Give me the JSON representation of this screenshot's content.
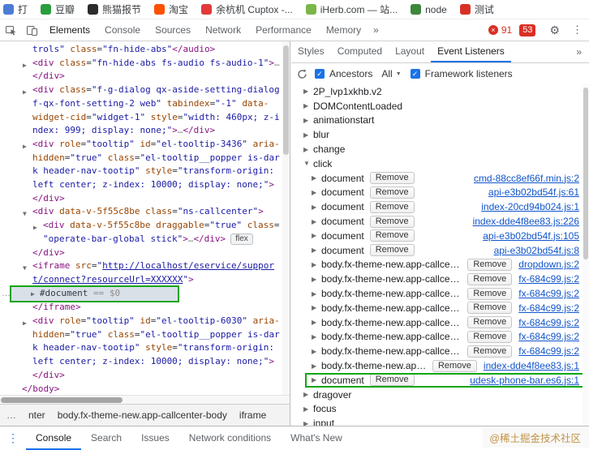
{
  "watermark": "@稀土掘金技术社区",
  "icons": {
    "gear": "⚙",
    "menu": "⋮",
    "drawer_menu": "⋮",
    "error": "×",
    "check": "✓",
    "dropdown": "▼",
    "twisty_collapsed": "▶",
    "twisty_expanded": "▼",
    "overflow": "…"
  },
  "bookmarks": [
    {
      "label": "打",
      "color": "#4d7cd6"
    },
    {
      "label": "豆瓣",
      "color": "#2a9d3f"
    },
    {
      "label": "熊猫报节",
      "color": "#2b2b2b"
    },
    {
      "label": "淘宝",
      "color": "#ff5000"
    },
    {
      "label": "余杭机 Cuptox -...",
      "color": "#e03a3a"
    },
    {
      "label": "iHerb.com — 站...",
      "color": "#7ab648"
    },
    {
      "label": "node",
      "color": "#3c873a"
    },
    {
      "label": "测试",
      "color": "#d93025"
    }
  ],
  "devtools": {
    "tabs": [
      "Elements",
      "Console",
      "Sources",
      "Network",
      "Performance",
      "Memory"
    ],
    "active_tab": "Elements",
    "more_tabs_icon": "»",
    "error_count": "91",
    "badge_count": "53"
  },
  "sidebar": {
    "tabs": [
      "Styles",
      "Computed",
      "Layout",
      "Event Listeners"
    ],
    "active_tab": "Event Listeners",
    "more_icon": "»",
    "toolbar": {
      "ancestors_label": "Ancestors",
      "filter_value": "All",
      "framework_label": "Framework listeners"
    },
    "remove_label": "Remove",
    "events": [
      {
        "name": "2P_lvp1xkhb.v2"
      },
      {
        "name": "DOMContentLoaded"
      },
      {
        "name": "animationstart"
      },
      {
        "name": "blur"
      },
      {
        "name": "change"
      },
      {
        "name": "click",
        "expanded": true,
        "listeners": [
          {
            "target": "document",
            "source": "cmd-88cc8ef66f.min.js:2"
          },
          {
            "target": "document",
            "source": "api-e3b02bd54f.js:61"
          },
          {
            "target": "document",
            "source": "index-20cd94b024.js:1"
          },
          {
            "target": "document",
            "source": "index-dde4f8ee83.js:226"
          },
          {
            "target": "document",
            "source": "api-e3b02bd54f.js:105"
          },
          {
            "target": "document",
            "source": "api-e3b02bd54f.js:8"
          },
          {
            "target": "body.fx-theme-new.app-callcenter-body",
            "source": "dropdown.js:2"
          },
          {
            "target": "body.fx-theme-new.app-callcenter-body",
            "source": "fx-684c99.js:2"
          },
          {
            "target": "body.fx-theme-new.app-callcenter-body",
            "source": "fx-684c99.js:2"
          },
          {
            "target": "body.fx-theme-new.app-callcenter-body",
            "source": "fx-684c99.js:2"
          },
          {
            "target": "body.fx-theme-new.app-callcenter-body",
            "source": "fx-684c99.js:2"
          },
          {
            "target": "body.fx-theme-new.app-callcenter-body",
            "source": "fx-684c99.js:2"
          },
          {
            "target": "body.fx-theme-new.app-callcenter-body",
            "source": "fx-684c99.js:2"
          },
          {
            "target": "body.fx-theme-new.app-callcenter-body",
            "source": "index-dde4f8ee83.js:1"
          },
          {
            "target": "document",
            "source": "udesk-phone-bar.es6.js:1",
            "highlight": true
          }
        ]
      },
      {
        "name": "dragover"
      },
      {
        "name": "focus"
      },
      {
        "name": "input"
      }
    ]
  },
  "elements": {
    "flex_badge": "flex",
    "breadcrumb": {
      "overflow": "…",
      "items": [
        "nter",
        "body.fx-theme-new.app-callcenter-body",
        "iframe"
      ]
    },
    "code_lines": [
      {
        "ind": 2,
        "seg": [
          [
            "v",
            "trols\" "
          ],
          [
            "a",
            "class"
          ],
          [
            "p",
            "="
          ],
          [
            "v",
            "\"fn-hide-abs\""
          ],
          [
            "t",
            "</audio>"
          ]
        ]
      },
      {
        "ind": 2,
        "arrow": "r",
        "seg": [
          [
            "t",
            "<div"
          ],
          [
            "p",
            " "
          ],
          [
            "a",
            "class"
          ],
          [
            "p",
            "="
          ],
          [
            "v",
            "\"fn-hide-abs fs-audio fs-audio-1\""
          ],
          [
            "t",
            ">"
          ],
          [
            "g",
            "…"
          ]
        ]
      },
      {
        "ind": 2,
        "seg": [
          [
            "t",
            "</div>"
          ]
        ]
      },
      {
        "ind": 2,
        "arrow": "r",
        "seg": [
          [
            "t",
            "<div"
          ],
          [
            "p",
            " "
          ],
          [
            "a",
            "class"
          ],
          [
            "p",
            "="
          ],
          [
            "v",
            "\"f-g-dialog qx-aside-setting-dialog"
          ]
        ]
      },
      {
        "ind": 2,
        "seg": [
          [
            "v",
            "f-qx-font-setting-2 web\""
          ],
          [
            "p",
            " "
          ],
          [
            "a",
            "tabindex"
          ],
          [
            "p",
            "="
          ],
          [
            "v",
            "\"-1\""
          ],
          [
            "p",
            " "
          ],
          [
            "a",
            "data-"
          ]
        ]
      },
      {
        "ind": 2,
        "seg": [
          [
            "a",
            "widget-cid"
          ],
          [
            "p",
            "="
          ],
          [
            "v",
            "\"widget-1\""
          ],
          [
            "p",
            " "
          ],
          [
            "a",
            "style"
          ],
          [
            "p",
            "="
          ],
          [
            "v",
            "\"width: 460px; z-i"
          ]
        ]
      },
      {
        "ind": 2,
        "seg": [
          [
            "v",
            "ndex: 999; display: none;\""
          ],
          [
            "t",
            ">"
          ],
          [
            "g",
            "…"
          ],
          [
            "t",
            "</div>"
          ]
        ]
      },
      {
        "ind": 2,
        "arrow": "r",
        "seg": [
          [
            "t",
            "<div"
          ],
          [
            "p",
            " "
          ],
          [
            "a",
            "role"
          ],
          [
            "p",
            "="
          ],
          [
            "v",
            "\"tooltip\""
          ],
          [
            "p",
            " "
          ],
          [
            "a",
            "id"
          ],
          [
            "p",
            "="
          ],
          [
            "v",
            "\"el-tooltip-3436\""
          ],
          [
            "p",
            " "
          ],
          [
            "a",
            "aria-"
          ]
        ]
      },
      {
        "ind": 2,
        "seg": [
          [
            "a",
            "hidden"
          ],
          [
            "p",
            "="
          ],
          [
            "v",
            "\"true\""
          ],
          [
            "p",
            " "
          ],
          [
            "a",
            "class"
          ],
          [
            "p",
            "="
          ],
          [
            "v",
            "\"el-tooltip__popper is-dar"
          ]
        ]
      },
      {
        "ind": 2,
        "seg": [
          [
            "v",
            "k header-nav-tootip\""
          ],
          [
            "p",
            " "
          ],
          [
            "a",
            "style"
          ],
          [
            "p",
            "="
          ],
          [
            "v",
            "\"transform-origin:"
          ]
        ]
      },
      {
        "ind": 2,
        "seg": [
          [
            "v",
            "left center; z-index: 10000; display: none;\""
          ],
          [
            "t",
            ">"
          ]
        ]
      },
      {
        "ind": 2,
        "seg": [
          [
            "t",
            "</div>"
          ]
        ]
      },
      {
        "ind": 2,
        "arrow": "d",
        "seg": [
          [
            "t",
            "<div"
          ],
          [
            "p",
            " "
          ],
          [
            "a",
            "data-v-5f55c8be"
          ],
          [
            "p",
            " "
          ],
          [
            "a",
            "class"
          ],
          [
            "p",
            "="
          ],
          [
            "v",
            "\"ns-callcenter\""
          ],
          [
            "t",
            ">"
          ]
        ]
      },
      {
        "ind": 3,
        "arrow": "r",
        "seg": [
          [
            "t",
            "<div"
          ],
          [
            "p",
            " "
          ],
          [
            "a",
            "data-v-5f55c8be"
          ],
          [
            "p",
            " "
          ],
          [
            "a",
            "draggable"
          ],
          [
            "p",
            "="
          ],
          [
            "v",
            "\"true\""
          ],
          [
            "p",
            " "
          ],
          [
            "a",
            "class"
          ],
          [
            "p",
            "="
          ]
        ]
      },
      {
        "ind": 3,
        "badge": true,
        "seg": [
          [
            "v",
            "\"operate-bar-global stick\""
          ],
          [
            "t",
            ">"
          ],
          [
            "g",
            "…"
          ],
          [
            "t",
            "</div>"
          ]
        ]
      },
      {
        "ind": 2,
        "seg": [
          [
            "t",
            "</div>"
          ]
        ]
      },
      {
        "ind": 2,
        "arrow": "d",
        "seg": [
          [
            "t",
            "<iframe"
          ],
          [
            "p",
            " "
          ],
          [
            "a",
            "src"
          ],
          [
            "p",
            "="
          ],
          [
            "v",
            "\""
          ],
          [
            "l",
            "http://localhost/eservice/suppor"
          ]
        ]
      },
      {
        "ind": 2,
        "seg": [
          [
            "l",
            "t/connect?resourceUrl=XXXXXX"
          ],
          [
            "v",
            "\""
          ],
          [
            "t",
            ">"
          ]
        ]
      },
      {
        "ind": 3,
        "sel": true,
        "gutter": true,
        "arrow": "r",
        "seg": [
          [
            "p",
            "#document"
          ],
          [
            "g",
            " == $0"
          ]
        ]
      },
      {
        "ind": 2,
        "seg": [
          [
            "t",
            "</iframe>"
          ]
        ]
      },
      {
        "ind": 2,
        "arrow": "r",
        "seg": [
          [
            "t",
            "<div"
          ],
          [
            "p",
            " "
          ],
          [
            "a",
            "role"
          ],
          [
            "p",
            "="
          ],
          [
            "v",
            "\"tooltip\""
          ],
          [
            "p",
            " "
          ],
          [
            "a",
            "id"
          ],
          [
            "p",
            "="
          ],
          [
            "v",
            "\"el-tooltip-6030\""
          ],
          [
            "p",
            " "
          ],
          [
            "a",
            "aria-"
          ]
        ]
      },
      {
        "ind": 2,
        "seg": [
          [
            "a",
            "hidden"
          ],
          [
            "p",
            "="
          ],
          [
            "v",
            "\"true\""
          ],
          [
            "p",
            " "
          ],
          [
            "a",
            "class"
          ],
          [
            "p",
            "="
          ],
          [
            "v",
            "\"el-tooltip__popper is-dar"
          ]
        ]
      },
      {
        "ind": 2,
        "seg": [
          [
            "v",
            "k header-nav-tootip\""
          ],
          [
            "p",
            " "
          ],
          [
            "a",
            "style"
          ],
          [
            "p",
            "="
          ],
          [
            "v",
            "\"transform-origin:"
          ]
        ]
      },
      {
        "ind": 2,
        "seg": [
          [
            "v",
            "left center; z-index: 10000; display: none;\""
          ],
          [
            "t",
            ">"
          ]
        ]
      },
      {
        "ind": 2,
        "seg": [
          [
            "t",
            "</div>"
          ]
        ]
      },
      {
        "ind": 1,
        "seg": [
          [
            "t",
            "</body>"
          ]
        ]
      }
    ]
  },
  "drawer": {
    "tabs": [
      "Console",
      "Search",
      "Issues",
      "Network conditions",
      "What's New"
    ],
    "active_tab": "Console"
  }
}
